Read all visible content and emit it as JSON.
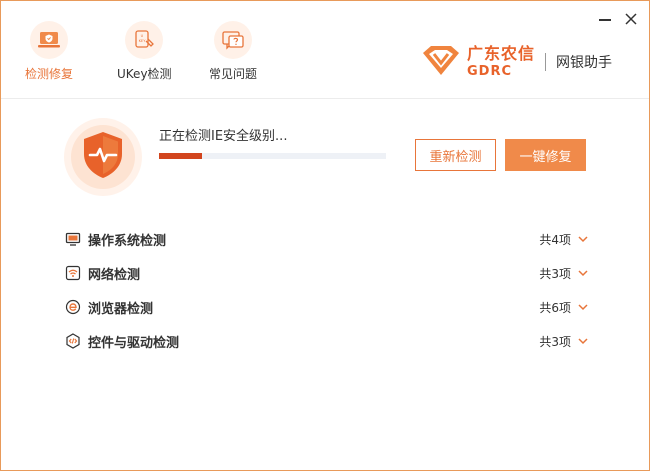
{
  "window": {
    "minimize_icon": "minimize-icon",
    "close_icon": "close-icon"
  },
  "tabs": [
    {
      "label": "检测修复",
      "icon": "laptop-shield-icon",
      "active": true
    },
    {
      "label": "UKey检测",
      "icon": "ukey-icon",
      "active": false
    },
    {
      "label": "常见问题",
      "icon": "faq-chat-icon",
      "active": false
    }
  ],
  "brand": {
    "name_cn": "广东农信",
    "name_en": "GDRC",
    "assistant": "网银助手",
    "logo_icon": "gdrc-logo-icon"
  },
  "status": {
    "text": "正在检测IE安全级别...",
    "progress": 0.19,
    "shield_icon": "shield-pulse-icon"
  },
  "buttons": {
    "rescan": "重新检测",
    "fix": "一键修复"
  },
  "checks": [
    {
      "label": "操作系统检测",
      "count": "共4项",
      "icon": "monitor-icon"
    },
    {
      "label": "网络检测",
      "count": "共3项",
      "icon": "wifi-icon"
    },
    {
      "label": "浏览器检测",
      "count": "共6项",
      "icon": "browser-e-icon"
    },
    {
      "label": "控件与驱动检测",
      "count": "共3项",
      "icon": "code-hexagon-icon"
    }
  ],
  "colors": {
    "accent": "#e8753a",
    "accent_dark": "#d2451e",
    "brand": "#e8622a",
    "button_fill": "#f08a4a"
  }
}
